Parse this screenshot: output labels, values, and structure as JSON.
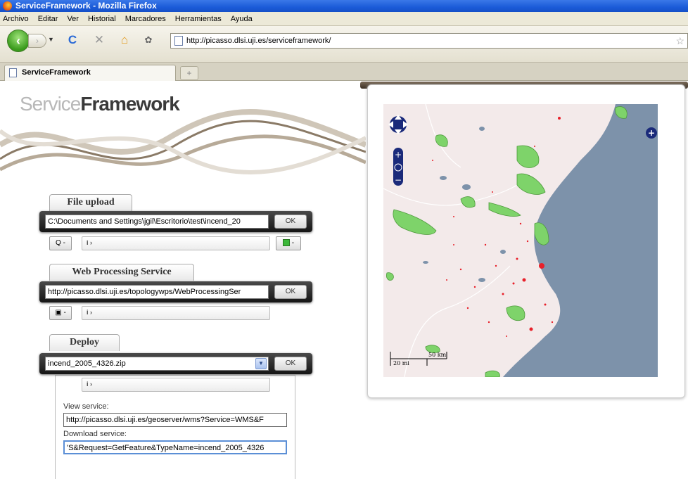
{
  "window": {
    "title": "ServiceFramework - Mozilla Firefox"
  },
  "menu": [
    "Archivo",
    "Editar",
    "Ver",
    "Historial",
    "Marcadores",
    "Herramientas",
    "Ayuda"
  ],
  "nav": {
    "url": "http://picasso.dlsi.uji.es/serviceframework/"
  },
  "tab": {
    "label": "ServiceFramework",
    "new_tab": "+"
  },
  "logo": {
    "light": "Service",
    "bold": "Framework"
  },
  "file_upload": {
    "title": "File upload",
    "path": "C:\\Documents and Settings\\jgil\\Escritorio\\test\\incend_20",
    "ok": "OK",
    "search_btn": "Q -",
    "info": "i ›",
    "color_btn": "-"
  },
  "wps": {
    "title": "Web Processing Service",
    "url": "http://picasso.dlsi.uji.es/topologywps/WebProcessingSer",
    "ok": "OK",
    "info": "i ›"
  },
  "deploy": {
    "title": "Deploy",
    "selected": "incend_2005_4326.zip",
    "ok": "OK",
    "info": "i ›",
    "view_label": "View service:",
    "view_url": "http://picasso.dlsi.uji.es/geoserver/wms?Service=WMS&F",
    "download_label": "Download  service:",
    "download_url": "'S&Request=GetFeature&TypeName=incend_2005_4326"
  },
  "map": {
    "scale_km": "50 km",
    "scale_mi": "20 mi",
    "colors": {
      "sea": "#7d92aa",
      "land": "#f3eaea",
      "parks": "#7ed36a",
      "fires": "#e8202a"
    }
  }
}
